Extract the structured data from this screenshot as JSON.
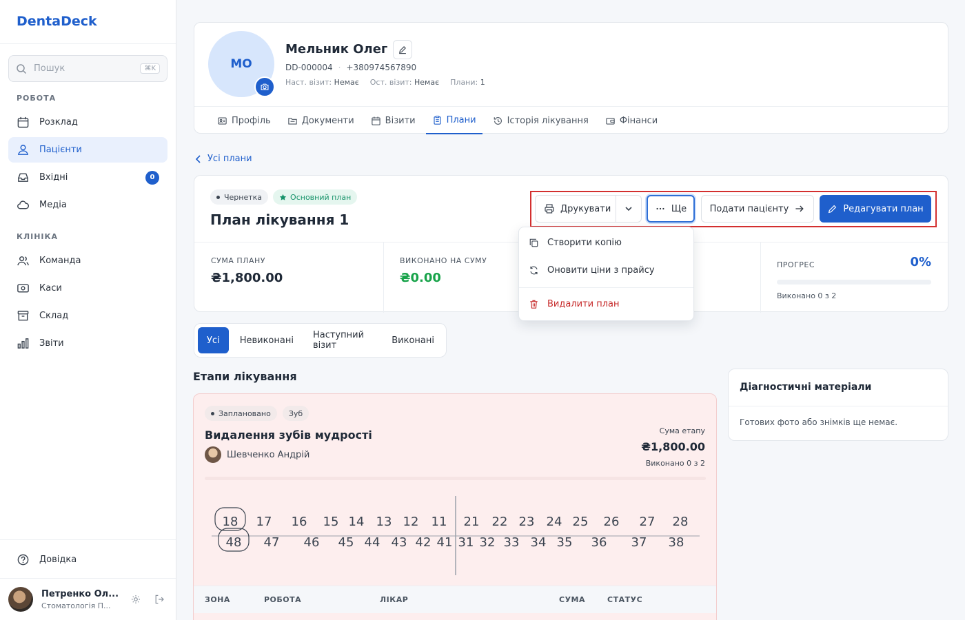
{
  "app": {
    "name": "DentaDeck"
  },
  "search": {
    "placeholder": "Пошук",
    "shortcut": "⌘K"
  },
  "sidebar": {
    "sections": [
      {
        "title": "РОБОТА",
        "items": [
          {
            "label": "Розклад",
            "icon": "calendar-icon"
          },
          {
            "label": "Пацієнти",
            "icon": "users-icon",
            "active": true
          },
          {
            "label": "Вхідні",
            "icon": "inbox-icon",
            "badge": "0"
          },
          {
            "label": "Медіа",
            "icon": "cloud-icon"
          }
        ]
      },
      {
        "title": "КЛІНІКА",
        "items": [
          {
            "label": "Команда",
            "icon": "team-icon"
          },
          {
            "label": "Каси",
            "icon": "cash-icon"
          },
          {
            "label": "Склад",
            "icon": "archive-icon"
          },
          {
            "label": "Звіти",
            "icon": "chart-icon"
          }
        ]
      }
    ],
    "help": "Довідка",
    "user": {
      "name": "Петренко Ол...",
      "role": "Стоматологія П..."
    }
  },
  "patient": {
    "initials": "МО",
    "name": "Мельник Олег",
    "id": "DD-000004",
    "phone": "+380974567890",
    "next_visit_label": "Наст. візит:",
    "next_visit_value": "Немає",
    "last_visit_label": "Ост. візит:",
    "last_visit_value": "Немає",
    "plans_label": "Плани:",
    "plans_value": "1",
    "tabs": [
      {
        "label": "Профіль",
        "icon": "id-card-icon"
      },
      {
        "label": "Документи",
        "icon": "folder-icon"
      },
      {
        "label": "Візити",
        "icon": "calendar-icon"
      },
      {
        "label": "Плани",
        "icon": "clipboard-icon",
        "active": true
      },
      {
        "label": "Історія лікування",
        "icon": "history-icon"
      },
      {
        "label": "Фінанси",
        "icon": "wallet-icon"
      }
    ]
  },
  "back_link": "Усі плани",
  "plan": {
    "status": "Чернетка",
    "primary": "Основний план",
    "title": "План лікування 1",
    "actions": {
      "print": "Друкувати",
      "more": "Ще",
      "send": "Подати пацієнту",
      "edit": "Редагувати план"
    },
    "stats": {
      "sum_label": "СУМА ПЛАНУ",
      "sum_value": "₴1,800.00",
      "done_label": "ВИКОНАНО НА СУМУ",
      "done_value": "₴0.00",
      "progress_label": "ПРОГРЕС",
      "progress_value": "0%",
      "progress_fraction": 0,
      "progress_note": "Виконано 0 з 2"
    },
    "colors": {
      "accent": "#1f5fcc",
      "done": "#18a34a",
      "danger": "#c62828"
    }
  },
  "more_menu": {
    "items": [
      {
        "label": "Створити копію",
        "icon": "copy-icon"
      },
      {
        "label": "Оновити ціни з прайсу",
        "icon": "refresh-icon"
      },
      {
        "label": "Видалити план",
        "icon": "trash-icon",
        "danger": true
      }
    ]
  },
  "filters": [
    "Усі",
    "Невиконані",
    "Наступний візит",
    "Виконані"
  ],
  "stages_heading": "Етапи лікування",
  "stage": {
    "status": "Заплановано",
    "type": "Зуб",
    "title": "Видалення зубів мудрості",
    "doctor": "Шевченко Андрій",
    "sum_label": "Сума етапу",
    "sum_value": "₴1,800.00",
    "sum_note": "Виконано 0 з 2",
    "teeth_upper": [
      "18",
      "17",
      "16",
      "15",
      "14",
      "13",
      "12",
      "11",
      "21",
      "22",
      "23",
      "24",
      "25",
      "26",
      "27",
      "28"
    ],
    "teeth_lower": [
      "48",
      "47",
      "46",
      "45",
      "44",
      "43",
      "42",
      "41",
      "31",
      "32",
      "33",
      "34",
      "35",
      "36",
      "37",
      "38"
    ],
    "selected_teeth": [
      "18",
      "48"
    ],
    "table_headers": [
      "ЗОНА",
      "РОБОТА",
      "ЛІКАР",
      "СУМА",
      "СТАТУС"
    ]
  },
  "diagnostics": {
    "title": "Діагностичні матеріали",
    "empty": "Готових фото або знімків ще немає."
  }
}
